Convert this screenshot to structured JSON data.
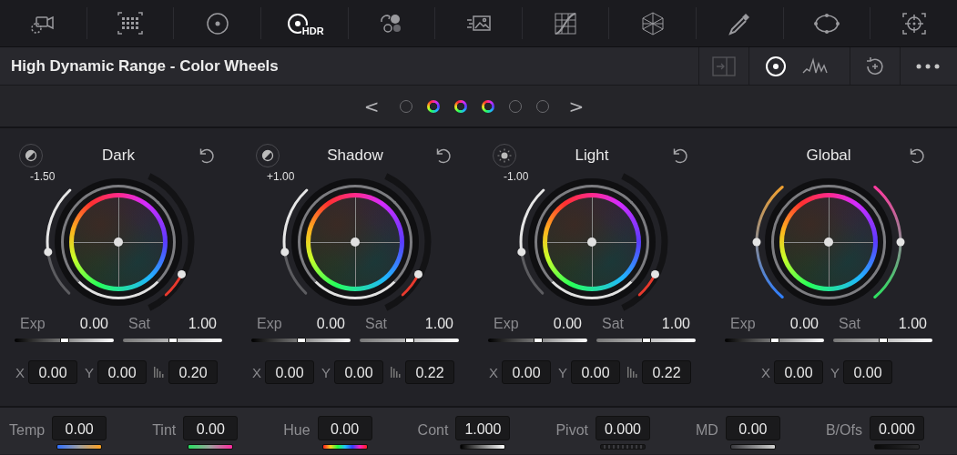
{
  "toolbar": {
    "tools": [
      {
        "kind": "camera",
        "selected": false
      },
      {
        "kind": "grid",
        "selected": false
      },
      {
        "kind": "wheel",
        "selected": false
      },
      {
        "kind": "hdr",
        "label": "HDR",
        "selected": true
      },
      {
        "kind": "circles",
        "selected": false
      },
      {
        "kind": "image",
        "selected": false
      },
      {
        "kind": "curves",
        "selected": false
      },
      {
        "kind": "mesh",
        "selected": false
      },
      {
        "kind": "dropper",
        "selected": false
      },
      {
        "kind": "window",
        "selected": false
      },
      {
        "kind": "target",
        "selected": false
      }
    ]
  },
  "header": {
    "title": "High Dynamic Range - Color Wheels",
    "view_modes": [
      {
        "kind": "wheels",
        "selected": true
      },
      {
        "kind": "waveform",
        "selected": false
      }
    ]
  },
  "pager": {
    "prev": "<",
    "next": ">",
    "pages": [
      {
        "selected": false
      },
      {
        "selected": true
      },
      {
        "selected": true
      },
      {
        "selected": true
      },
      {
        "selected": false
      },
      {
        "selected": false
      }
    ]
  },
  "wheels": [
    {
      "name": "Dark",
      "kind": "dark",
      "zone_value": "-1.50",
      "exp": {
        "label": "Exp",
        "value": "0.00",
        "level": 0.5
      },
      "sat": {
        "label": "Sat",
        "value": "1.00",
        "level": 0.5
      },
      "x": {
        "label": "X",
        "value": "0.00"
      },
      "y": {
        "label": "Y",
        "value": "0.00"
      },
      "falloff": "0.20"
    },
    {
      "name": "Shadow",
      "kind": "dark",
      "zone_value": "+1.00",
      "exp": {
        "label": "Exp",
        "value": "0.00",
        "level": 0.5
      },
      "sat": {
        "label": "Sat",
        "value": "1.00",
        "level": 0.5
      },
      "x": {
        "label": "X",
        "value": "0.00"
      },
      "y": {
        "label": "Y",
        "value": "0.00"
      },
      "falloff": "0.22"
    },
    {
      "name": "Light",
      "kind": "light",
      "zone_value": "-1.00",
      "exp": {
        "label": "Exp",
        "value": "0.00",
        "level": 0.5
      },
      "sat": {
        "label": "Sat",
        "value": "1.00",
        "level": 0.5
      },
      "x": {
        "label": "X",
        "value": "0.00"
      },
      "y": {
        "label": "Y",
        "value": "0.00"
      },
      "falloff": "0.22"
    },
    {
      "name": "Global",
      "kind": "global",
      "exp": {
        "label": "Exp",
        "value": "0.00",
        "level": 0.5
      },
      "sat": {
        "label": "Sat",
        "value": "1.00",
        "level": 0.5
      },
      "x": {
        "label": "X",
        "value": "0.00"
      },
      "y": {
        "label": "Y",
        "value": "0.00"
      }
    }
  ],
  "bottom_bar": {
    "controls": [
      {
        "label": "Temp",
        "value": "0.00",
        "kind": "temp"
      },
      {
        "label": "Tint",
        "value": "0.00",
        "kind": "tint"
      },
      {
        "label": "Hue",
        "value": "0.00",
        "kind": "hue"
      },
      {
        "label": "Cont",
        "value": "1.000",
        "kind": "contrast"
      },
      {
        "label": "Pivot",
        "value": "0.000",
        "kind": "pivot"
      },
      {
        "label": "MD",
        "value": "0.00",
        "kind": "md"
      },
      {
        "label": "B/Ofs",
        "value": "0.000",
        "kind": "offset"
      }
    ]
  }
}
